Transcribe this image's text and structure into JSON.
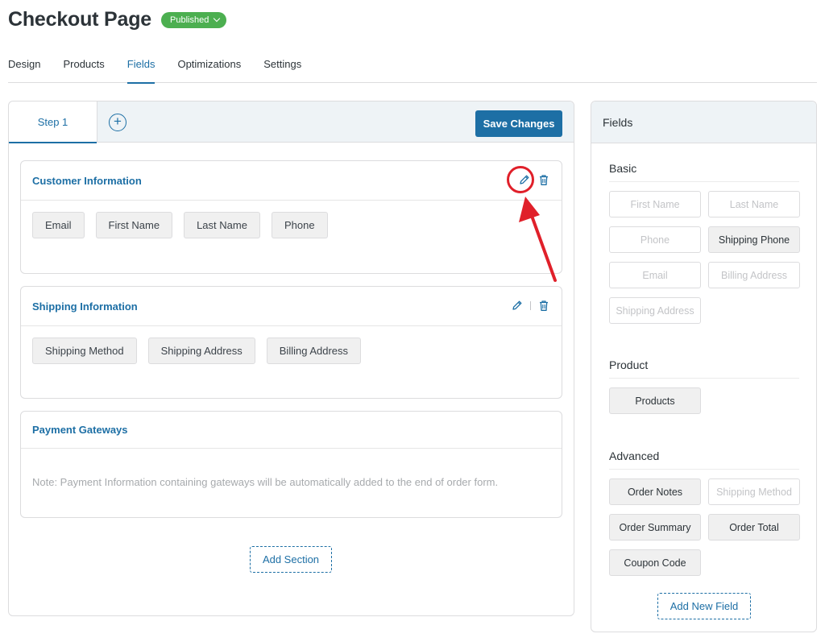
{
  "header": {
    "title": "Checkout Page",
    "status": "Published"
  },
  "tabs": [
    "Design",
    "Products",
    "Fields",
    "Optimizations",
    "Settings"
  ],
  "active_tab": "Fields",
  "builder": {
    "step_label": "Step 1",
    "add_step_symbol": "+",
    "save_label": "Save Changes",
    "sections": {
      "customer": {
        "title": "Customer Information",
        "fields": [
          "Email",
          "First Name",
          "Last Name",
          "Phone"
        ]
      },
      "shipping": {
        "title": "Shipping Information",
        "fields": [
          "Shipping Method",
          "Shipping Address",
          "Billing Address"
        ]
      },
      "payment": {
        "title": "Payment Gateways",
        "note": "Note: Payment Information containing gateways will be automatically added to the end of order form."
      }
    },
    "add_section_label": "Add Section"
  },
  "fields_panel": {
    "title": "Fields",
    "basic": {
      "title": "Basic",
      "items": [
        {
          "label": "First Name",
          "enabled": false
        },
        {
          "label": "Last Name",
          "enabled": false
        },
        {
          "label": "Phone",
          "enabled": false
        },
        {
          "label": "Shipping Phone",
          "enabled": true
        },
        {
          "label": "Email",
          "enabled": false
        },
        {
          "label": "Billing Address",
          "enabled": false
        },
        {
          "label": "Shipping Address",
          "enabled": false
        }
      ]
    },
    "product": {
      "title": "Product",
      "items": [
        {
          "label": "Products",
          "enabled": true
        }
      ]
    },
    "advanced": {
      "title": "Advanced",
      "items": [
        {
          "label": "Order Notes",
          "enabled": true
        },
        {
          "label": "Shipping Method",
          "enabled": false
        },
        {
          "label": "Order Summary",
          "enabled": true
        },
        {
          "label": "Order Total",
          "enabled": true
        },
        {
          "label": "Coupon Code",
          "enabled": true
        }
      ]
    },
    "add_field_label": "Add New Field"
  },
  "colors": {
    "accent": "#1d6fa5",
    "published": "#4caf50",
    "annotation": "#e0202a"
  },
  "icons": [
    "chevron-down-icon",
    "plus-circle-icon",
    "pencil-icon",
    "trash-icon",
    "red-arrow-annotation"
  ]
}
